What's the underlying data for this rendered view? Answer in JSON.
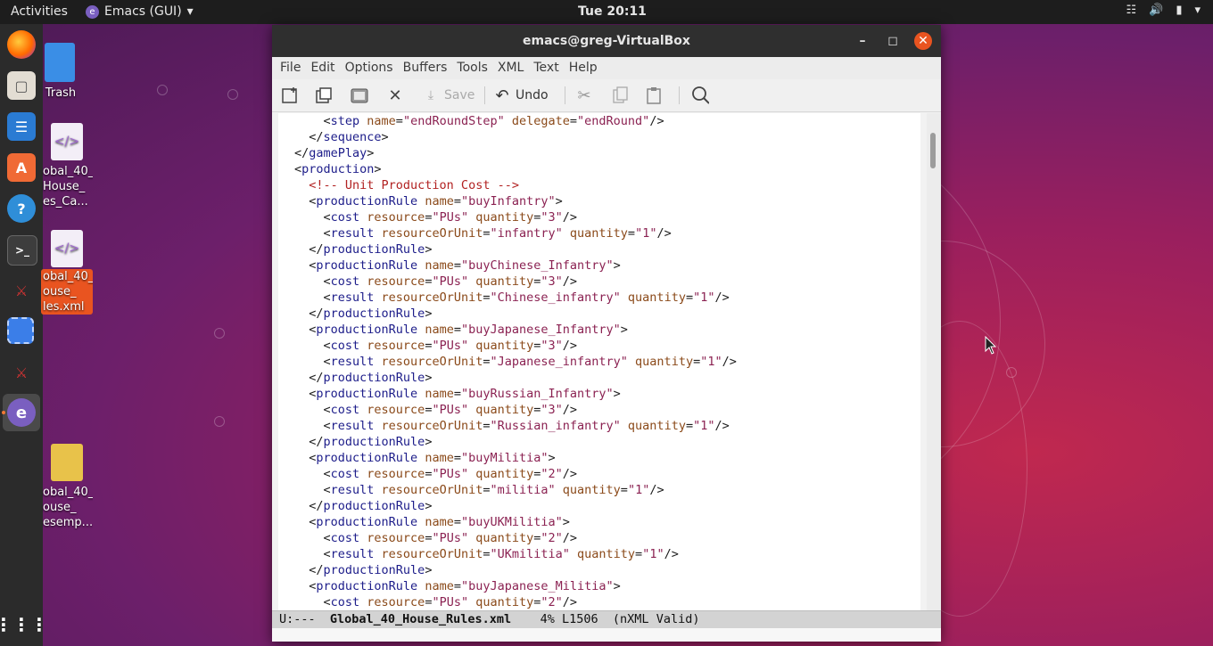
{
  "topbar": {
    "activities": "Activities",
    "app_name": "Emacs (GUI)",
    "app_menu_arrow": "▾",
    "clock": "Tue 20:11",
    "tray": [
      "network-icon",
      "volume-icon",
      "battery-icon",
      "system-menu-arrow"
    ]
  },
  "dock": {
    "items": [
      "firefox-icon",
      "files-icon",
      "libreoffice-writer-icon",
      "ubuntu-software-icon",
      "help-icon",
      "terminal-icon",
      "triplea-icon",
      "screenshot-icon",
      "triplea-icon-2",
      "emacs-icon"
    ],
    "show_apps": "show-applications-icon"
  },
  "desktop": {
    "trash_label": "Trash",
    "icon1_label": "obal_40_\nHouse_\nes_Ca...",
    "icon2_label": "obal_40_\nouse_\nles.xml",
    "icon3_label": "obal_40_\nouse_\nesemp..."
  },
  "window": {
    "title": "emacs@greg-VirtualBox",
    "menu": [
      "File",
      "Edit",
      "Options",
      "Buffers",
      "Tools",
      "XML",
      "Text",
      "Help"
    ],
    "toolbar": {
      "save_label": "Save",
      "undo_label": "Undo"
    },
    "editor_lines": [
      [
        [
          "pn",
          "    <"
        ],
        [
          "tg",
          "step"
        ],
        [
          "at",
          " name"
        ],
        [
          "pn",
          "="
        ],
        [
          "vl",
          "\"endRoundStep\""
        ],
        [
          "at",
          " delegate"
        ],
        [
          "pn",
          "="
        ],
        [
          "vl",
          "\"endRound\""
        ],
        [
          "pn",
          "/>"
        ]
      ],
      [
        [
          "pn",
          "  </"
        ],
        [
          "tg",
          "sequence"
        ],
        [
          "pn",
          ">"
        ]
      ],
      [
        [
          "pn",
          "</"
        ],
        [
          "tg",
          "gamePlay"
        ],
        [
          "pn",
          ">"
        ]
      ],
      [
        [
          "pn",
          "<"
        ],
        [
          "tg",
          "production"
        ],
        [
          "pn",
          ">"
        ]
      ],
      [
        [
          "cm",
          "  <!-- Unit Production Cost -->"
        ]
      ],
      [
        [
          "pn",
          "  <"
        ],
        [
          "tg",
          "productionRule"
        ],
        [
          "at",
          " name"
        ],
        [
          "pn",
          "="
        ],
        [
          "vl",
          "\"buyInfantry\""
        ],
        [
          "pn",
          ">"
        ]
      ],
      [
        [
          "pn",
          "    <"
        ],
        [
          "tg",
          "cost"
        ],
        [
          "at",
          " resource"
        ],
        [
          "pn",
          "="
        ],
        [
          "vl",
          "\"PUs\""
        ],
        [
          "at",
          " quantity"
        ],
        [
          "pn",
          "="
        ],
        [
          "vl",
          "\"3\""
        ],
        [
          "pn",
          "/>"
        ]
      ],
      [
        [
          "pn",
          "    <"
        ],
        [
          "tg",
          "result"
        ],
        [
          "at",
          " resourceOrUnit"
        ],
        [
          "pn",
          "="
        ],
        [
          "vl",
          "\"infantry\""
        ],
        [
          "at",
          " quantity"
        ],
        [
          "pn",
          "="
        ],
        [
          "vl",
          "\"1\""
        ],
        [
          "pn",
          "/>"
        ]
      ],
      [
        [
          "pn",
          "  </"
        ],
        [
          "tg",
          "productionRule"
        ],
        [
          "pn",
          ">"
        ]
      ],
      [
        [
          "pn",
          "  <"
        ],
        [
          "tg",
          "productionRule"
        ],
        [
          "at",
          " name"
        ],
        [
          "pn",
          "="
        ],
        [
          "vl",
          "\"buyChinese_Infantry\""
        ],
        [
          "pn",
          ">"
        ]
      ],
      [
        [
          "pn",
          "    <"
        ],
        [
          "tg",
          "cost"
        ],
        [
          "at",
          " resource"
        ],
        [
          "pn",
          "="
        ],
        [
          "vl",
          "\"PUs\""
        ],
        [
          "at",
          " quantity"
        ],
        [
          "pn",
          "="
        ],
        [
          "vl",
          "\"3\""
        ],
        [
          "pn",
          "/>"
        ]
      ],
      [
        [
          "pn",
          "    <"
        ],
        [
          "tg",
          "result"
        ],
        [
          "at",
          " resourceOrUnit"
        ],
        [
          "pn",
          "="
        ],
        [
          "vl",
          "\"Chinese_infantry\""
        ],
        [
          "at",
          " quantity"
        ],
        [
          "pn",
          "="
        ],
        [
          "vl",
          "\"1\""
        ],
        [
          "pn",
          "/>"
        ]
      ],
      [
        [
          "pn",
          "  </"
        ],
        [
          "tg",
          "productionRule"
        ],
        [
          "pn",
          ">"
        ]
      ],
      [
        [
          "pn",
          "  <"
        ],
        [
          "tg",
          "productionRule"
        ],
        [
          "at",
          " name"
        ],
        [
          "pn",
          "="
        ],
        [
          "vl",
          "\"buyJapanese_Infantry\""
        ],
        [
          "pn",
          ">"
        ]
      ],
      [
        [
          "pn",
          "    <"
        ],
        [
          "tg",
          "cost"
        ],
        [
          "at",
          " resource"
        ],
        [
          "pn",
          "="
        ],
        [
          "vl",
          "\"PUs\""
        ],
        [
          "at",
          " quantity"
        ],
        [
          "pn",
          "="
        ],
        [
          "vl",
          "\"3\""
        ],
        [
          "pn",
          "/>"
        ]
      ],
      [
        [
          "pn",
          "    <"
        ],
        [
          "tg",
          "result"
        ],
        [
          "at",
          " resourceOrUnit"
        ],
        [
          "pn",
          "="
        ],
        [
          "vl",
          "\"Japanese_infantry\""
        ],
        [
          "at",
          " quantity"
        ],
        [
          "pn",
          "="
        ],
        [
          "vl",
          "\"1\""
        ],
        [
          "pn",
          "/>"
        ]
      ],
      [
        [
          "pn",
          "  </"
        ],
        [
          "tg",
          "productionRule"
        ],
        [
          "pn",
          ">"
        ]
      ],
      [
        [
          "pn",
          "  <"
        ],
        [
          "tg",
          "productionRule"
        ],
        [
          "at",
          " name"
        ],
        [
          "pn",
          "="
        ],
        [
          "vl",
          "\"buyRussian_Infantry\""
        ],
        [
          "pn",
          ">"
        ]
      ],
      [
        [
          "pn",
          "    <"
        ],
        [
          "tg",
          "cost"
        ],
        [
          "at",
          " resource"
        ],
        [
          "pn",
          "="
        ],
        [
          "vl",
          "\"PUs\""
        ],
        [
          "at",
          " quantity"
        ],
        [
          "pn",
          "="
        ],
        [
          "vl",
          "\"3\""
        ],
        [
          "pn",
          "/>"
        ]
      ],
      [
        [
          "pn",
          "    <"
        ],
        [
          "tg",
          "result"
        ],
        [
          "at",
          " resourceOrUnit"
        ],
        [
          "pn",
          "="
        ],
        [
          "vl",
          "\"Russian_infantry\""
        ],
        [
          "at",
          " quantity"
        ],
        [
          "pn",
          "="
        ],
        [
          "vl",
          "\"1\""
        ],
        [
          "pn",
          "/>"
        ]
      ],
      [
        [
          "pn",
          "  </"
        ],
        [
          "tg",
          "productionRule"
        ],
        [
          "pn",
          ">"
        ]
      ],
      [
        [
          "pn",
          "  <"
        ],
        [
          "tg",
          "productionRule"
        ],
        [
          "at",
          " name"
        ],
        [
          "pn",
          "="
        ],
        [
          "vl",
          "\"buyMilitia\""
        ],
        [
          "pn",
          ">"
        ]
      ],
      [
        [
          "pn",
          "    <"
        ],
        [
          "tg",
          "cost"
        ],
        [
          "at",
          " resource"
        ],
        [
          "pn",
          "="
        ],
        [
          "vl",
          "\"PUs\""
        ],
        [
          "at",
          " quantity"
        ],
        [
          "pn",
          "="
        ],
        [
          "vl",
          "\"2\""
        ],
        [
          "pn",
          "/>"
        ]
      ],
      [
        [
          "pn",
          "    <"
        ],
        [
          "tg",
          "result"
        ],
        [
          "at",
          " resourceOrUnit"
        ],
        [
          "pn",
          "="
        ],
        [
          "vl",
          "\"militia\""
        ],
        [
          "at",
          " quantity"
        ],
        [
          "pn",
          "="
        ],
        [
          "vl",
          "\"1\""
        ],
        [
          "pn",
          "/>"
        ]
      ],
      [
        [
          "pn",
          "  </"
        ],
        [
          "tg",
          "productionRule"
        ],
        [
          "pn",
          ">"
        ]
      ],
      [
        [
          "pn",
          "  <"
        ],
        [
          "tg",
          "productionRule"
        ],
        [
          "at",
          " name"
        ],
        [
          "pn",
          "="
        ],
        [
          "vl",
          "\"buyUKMilitia\""
        ],
        [
          "pn",
          ">"
        ]
      ],
      [
        [
          "pn",
          "    <"
        ],
        [
          "tg",
          "cost"
        ],
        [
          "at",
          " resource"
        ],
        [
          "pn",
          "="
        ],
        [
          "vl",
          "\"PUs\""
        ],
        [
          "at",
          " quantity"
        ],
        [
          "pn",
          "="
        ],
        [
          "vl",
          "\"2\""
        ],
        [
          "pn",
          "/>"
        ]
      ],
      [
        [
          "pn",
          "    <"
        ],
        [
          "tg",
          "result"
        ],
        [
          "at",
          " resourceOrUnit"
        ],
        [
          "pn",
          "="
        ],
        [
          "vl",
          "\"UKmilitia\""
        ],
        [
          "at",
          " quantity"
        ],
        [
          "pn",
          "="
        ],
        [
          "vl",
          "\"1\""
        ],
        [
          "pn",
          "/>"
        ]
      ],
      [
        [
          "pn",
          "  </"
        ],
        [
          "tg",
          "productionRule"
        ],
        [
          "pn",
          ">"
        ]
      ],
      [
        [
          "pn",
          "  <"
        ],
        [
          "tg",
          "productionRule"
        ],
        [
          "at",
          " name"
        ],
        [
          "pn",
          "="
        ],
        [
          "vl",
          "\"buyJapanese_Militia\""
        ],
        [
          "pn",
          ">"
        ]
      ],
      [
        [
          "pn",
          "    <"
        ],
        [
          "tg",
          "cost"
        ],
        [
          "at",
          " resource"
        ],
        [
          "pn",
          "="
        ],
        [
          "vl",
          "\"PUs\""
        ],
        [
          "at",
          " quantity"
        ],
        [
          "pn",
          "="
        ],
        [
          "vl",
          "\"2\""
        ],
        [
          "pn",
          "/>"
        ]
      ]
    ],
    "modeline": {
      "status": "U:---",
      "buffer": "Global_40_House_Rules.xml",
      "position": "4% L1506",
      "mode": "(nXML Valid)"
    }
  },
  "colors": {
    "accent": "#e95420",
    "topbar": "#1d1d1d",
    "dock": "#2b2b2b"
  }
}
